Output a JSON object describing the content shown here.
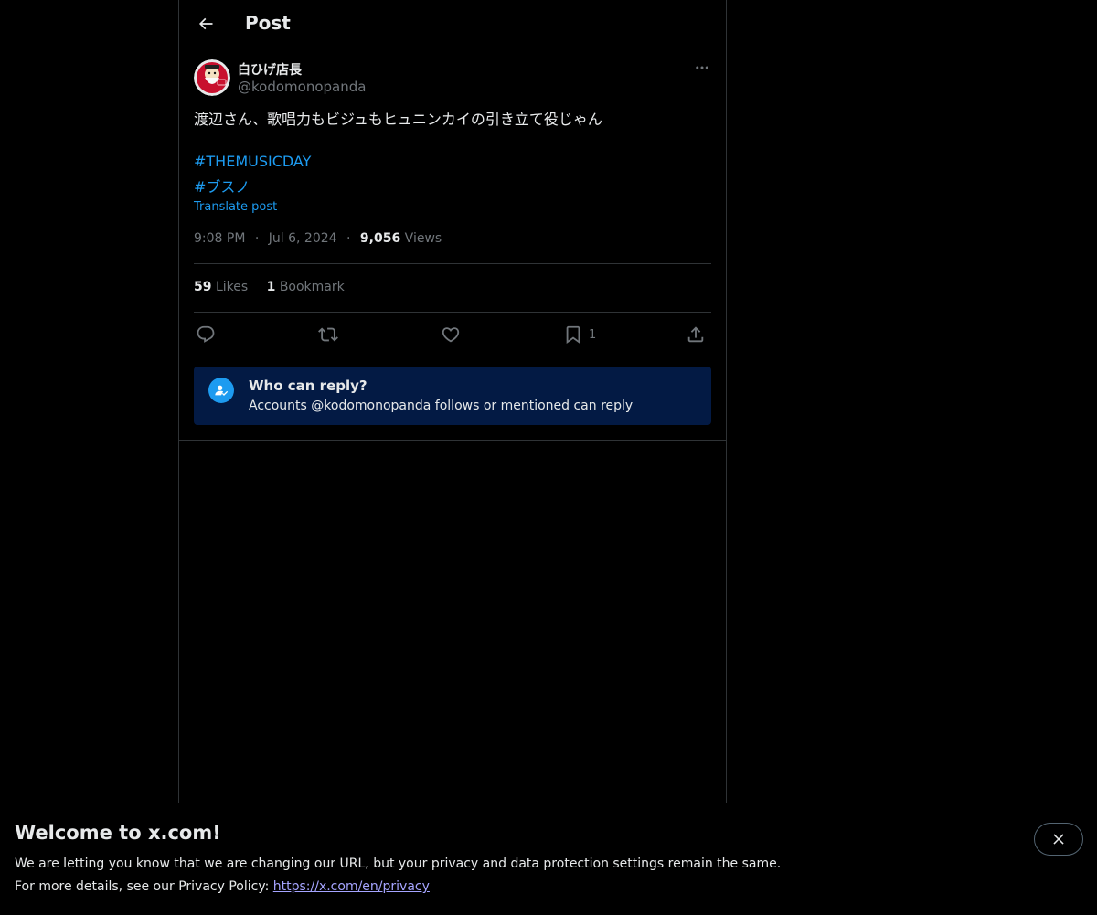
{
  "header": {
    "title": "Post",
    "back_icon": "arrow-left-icon"
  },
  "author": {
    "display_name": "白ひげ店長",
    "handle": "@kodomonopanda",
    "more_icon": "more-horizontal-icon"
  },
  "post": {
    "text": "渡辺さん、歌唱力もビジュもヒュニンカイの引き立て役じゃん",
    "hashtags": [
      "#THEMUSICDAY",
      "#ブスノ"
    ],
    "translate_label": "Translate post",
    "time": "9:08 PM",
    "date": "Jul 6, 2024",
    "views_count": "9,056",
    "views_label": "Views",
    "separator": "·"
  },
  "stats": {
    "likes_count": "59",
    "likes_label": "Likes",
    "bookmarks_count": "1",
    "bookmarks_label": "Bookmark"
  },
  "actions": {
    "reply_icon": "reply-icon",
    "repost_icon": "repost-icon",
    "like_icon": "heart-icon",
    "bookmark_icon": "bookmark-icon",
    "bookmark_count": "1",
    "share_icon": "share-icon"
  },
  "who_can_reply": {
    "title": "Who can reply?",
    "description": "Accounts @kodomonopanda follows or mentioned can reply"
  },
  "banner": {
    "title": "Welcome to x.com!",
    "line1": "We are letting you know that we are changing our URL, but your privacy and data protection settings remain the same.",
    "line2_prefix": "For more details, see our Privacy Policy: ",
    "link": "https://x.com/en/privacy",
    "close_icon": "close-icon"
  },
  "colors": {
    "background": "#000000",
    "accent": "#1d9bf0",
    "text": "#e7e9ea",
    "muted": "#71767b",
    "border": "#2f3336",
    "reply_box": "#031a44"
  }
}
